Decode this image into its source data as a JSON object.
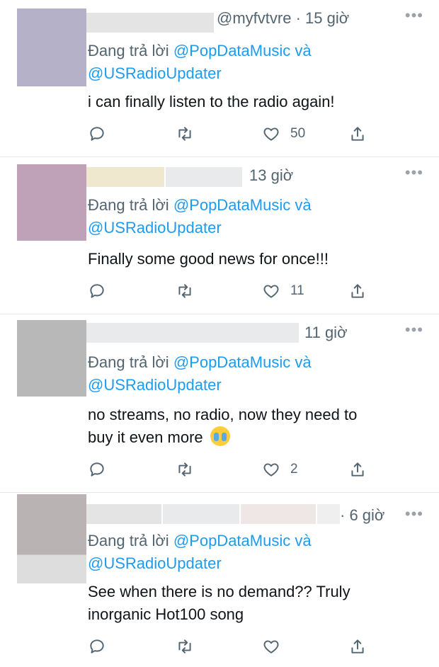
{
  "colors": {
    "mention": "#1d9bf0",
    "secondary_text": "#536471",
    "divider": "#e6e9ec"
  },
  "tweets": [
    {
      "handle": "@myfvtvre",
      "time": "· 15 giờ",
      "reply_prefix": "Đang trả lời",
      "mention1": "@PopDataMusic",
      "conj": "và",
      "mention2": "@USRadioUpdater",
      "text": "i can finally listen to the radio again!",
      "like_count": "50"
    },
    {
      "handle": "",
      "time": "13 giờ",
      "reply_prefix": "Đang trả lời",
      "mention1": "@PopDataMusic",
      "conj": "và",
      "mention2": "@USRadioUpdater",
      "text": "Finally some good news for once!!!",
      "like_count": "11"
    },
    {
      "handle": "",
      "time": "11 giờ",
      "reply_prefix": "Đang trả lời",
      "mention1": "@PopDataMusic",
      "conj": "và",
      "mention2": "@USRadioUpdater",
      "text_line1": "no streams, no radio, now they need to",
      "text_line2": "buy it even more",
      "emoji": "loudly-crying-face",
      "like_count": "2"
    },
    {
      "handle": "",
      "time": "· 6 giờ",
      "reply_prefix": "Đang trả lời",
      "mention1": "@PopDataMusic",
      "conj": "và",
      "mention2": "@USRadioUpdater",
      "text_line1": "See when there is no demand?? Truly",
      "text_line2": "inorganic Hot100 song",
      "like_count": ""
    }
  ],
  "icons": {
    "reply": "reply-icon",
    "retweet": "retweet-icon",
    "like": "heart-icon",
    "share": "share-icon",
    "more": "more-options-icon"
  },
  "more_glyph": "•••"
}
